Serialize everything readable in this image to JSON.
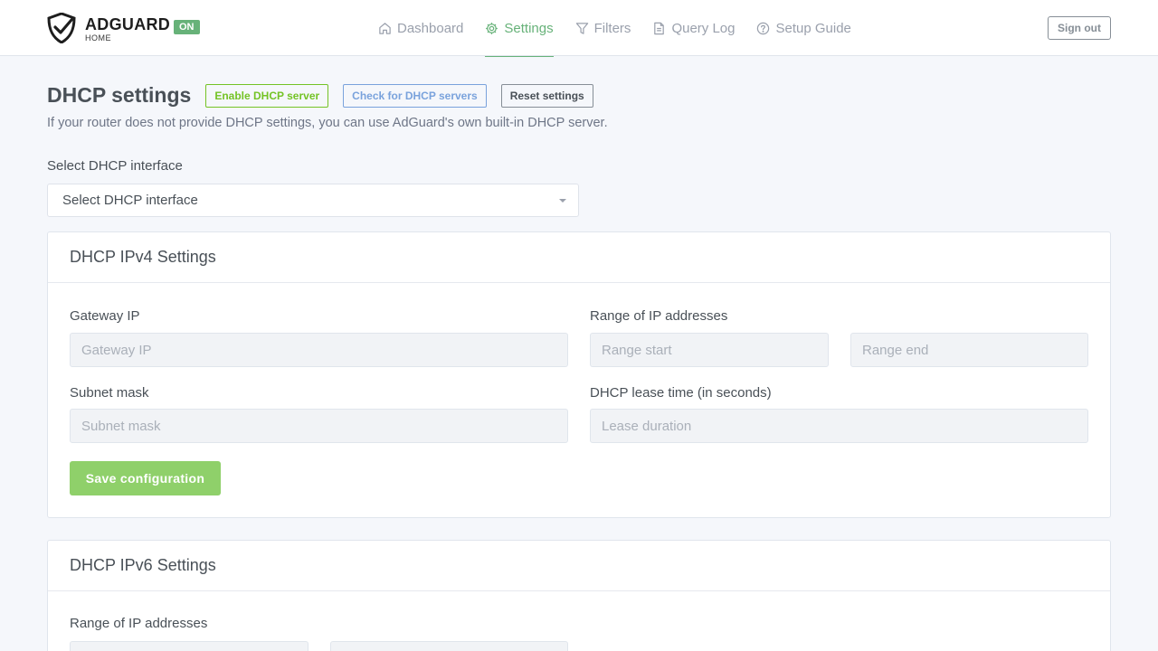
{
  "header": {
    "brand": "ADGUARD",
    "brand_sub": "HOME",
    "status_badge": "ON",
    "nav": [
      {
        "label": "Dashboard",
        "icon": "home-icon",
        "active": false
      },
      {
        "label": "Settings",
        "icon": "gear-icon",
        "active": true
      },
      {
        "label": "Filters",
        "icon": "filter-icon",
        "active": false
      },
      {
        "label": "Query Log",
        "icon": "document-icon",
        "active": false
      },
      {
        "label": "Setup Guide",
        "icon": "help-circle-icon",
        "active": false
      }
    ],
    "signout_label": "Sign out"
  },
  "page": {
    "title": "DHCP settings",
    "enable_btn": "Enable DHCP server",
    "check_btn": "Check for DHCP servers",
    "reset_btn": "Reset settings",
    "subtitle": "If your router does not provide DHCP settings, you can use AdGuard's own built-in DHCP server."
  },
  "interface": {
    "label": "Select DHCP interface",
    "selected": "Select DHCP interface"
  },
  "ipv4": {
    "title": "DHCP IPv4 Settings",
    "gateway_label": "Gateway IP",
    "gateway_placeholder": "Gateway IP",
    "range_label": "Range of IP addresses",
    "range_start_placeholder": "Range start",
    "range_end_placeholder": "Range end",
    "subnet_label": "Subnet mask",
    "subnet_placeholder": "Subnet mask",
    "lease_label": "DHCP lease time (in seconds)",
    "lease_placeholder": "Lease duration",
    "save_label": "Save configuration"
  },
  "ipv6": {
    "title": "DHCP IPv6 Settings",
    "range_label": "Range of IP addresses"
  },
  "colors": {
    "accent": "#67b279",
    "save_button": "#8fd06a",
    "background": "#f5f7fb"
  }
}
